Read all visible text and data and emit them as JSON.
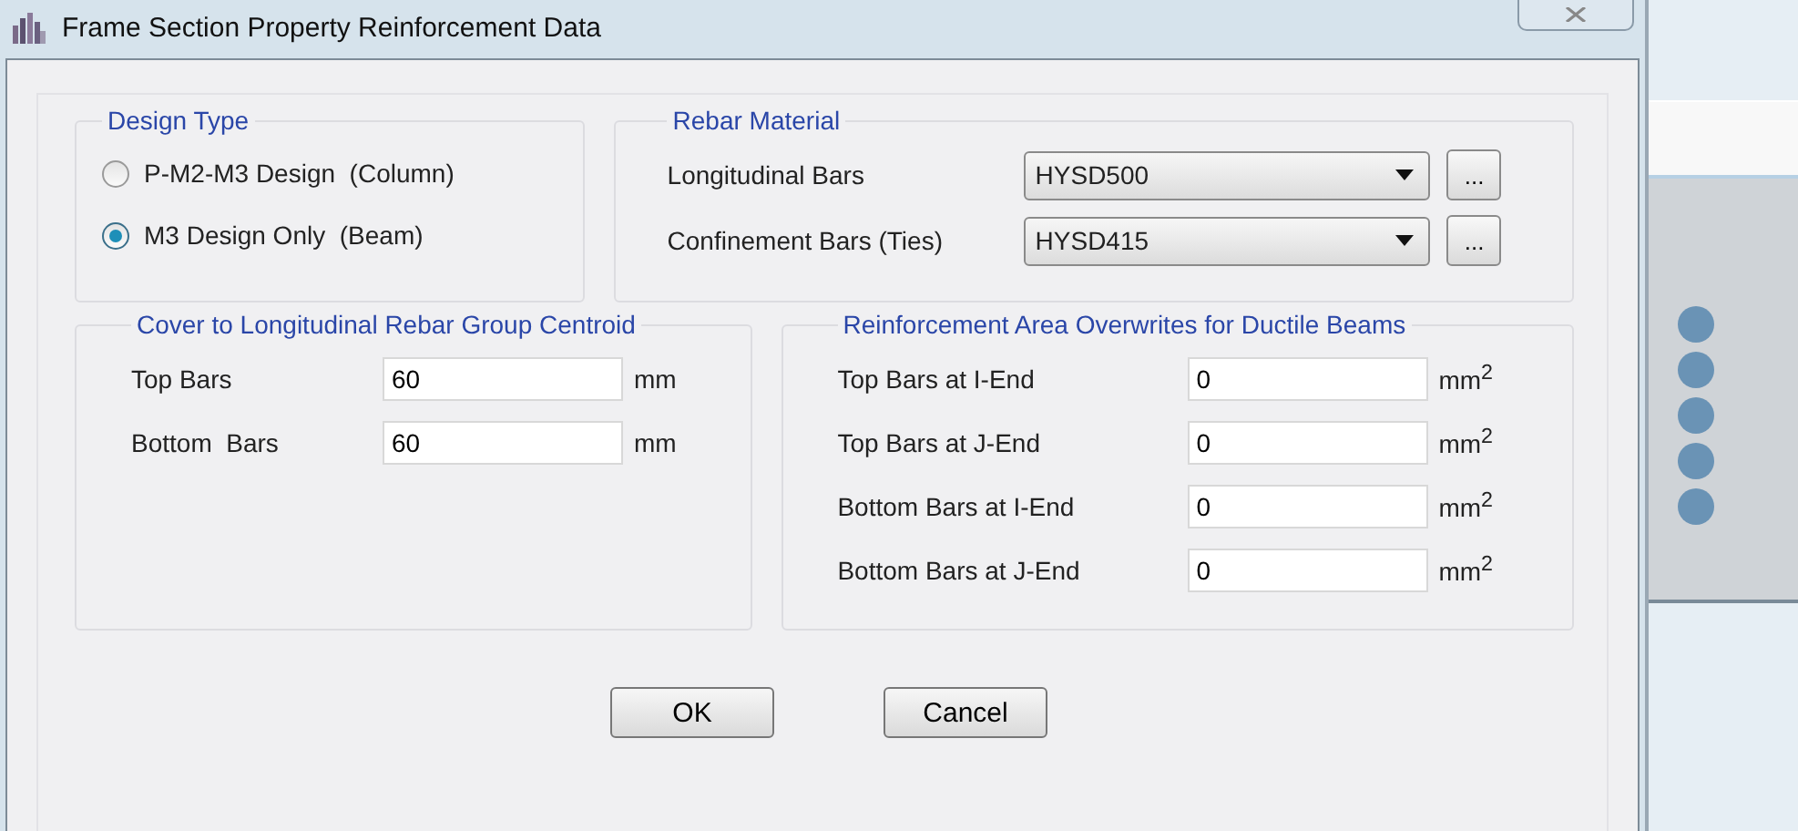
{
  "window": {
    "title": "Frame Section Property Reinforcement Data"
  },
  "design_type": {
    "title": "Design Type",
    "options": [
      {
        "label": "P-M2-M3 Design  (Column)",
        "selected": false
      },
      {
        "label": "M3 Design Only  (Beam)",
        "selected": true
      }
    ]
  },
  "rebar_material": {
    "title": "Rebar Material",
    "rows": [
      {
        "label": "Longitudinal Bars",
        "value": "HYSD500",
        "button": "..."
      },
      {
        "label": "Confinement Bars (Ties)",
        "value": "HYSD415",
        "button": "..."
      }
    ]
  },
  "cover": {
    "title": "Cover to Longitudinal Rebar Group Centroid",
    "rows": [
      {
        "label": "Top Bars",
        "value": "60",
        "unit": "mm"
      },
      {
        "label": "Bottom  Bars",
        "value": "60",
        "unit": "mm"
      }
    ]
  },
  "overwrites": {
    "title": "Reinforcement Area Overwrites for Ductile Beams",
    "rows": [
      {
        "label": "Top Bars at I-End",
        "value": "0",
        "unit": "mm$^{2}$"
      },
      {
        "label": "Top Bars at J-End",
        "value": "0",
        "unit": "mm$^{2}$"
      },
      {
        "label": "Bottom Bars at I-End",
        "value": "0",
        "unit": "mm$^{2}$"
      },
      {
        "label": "Bottom Bars at J-End",
        "value": "0",
        "unit": "mm$^{2}$"
      }
    ]
  },
  "buttons": [
    "OK",
    "Cancel"
  ]
}
